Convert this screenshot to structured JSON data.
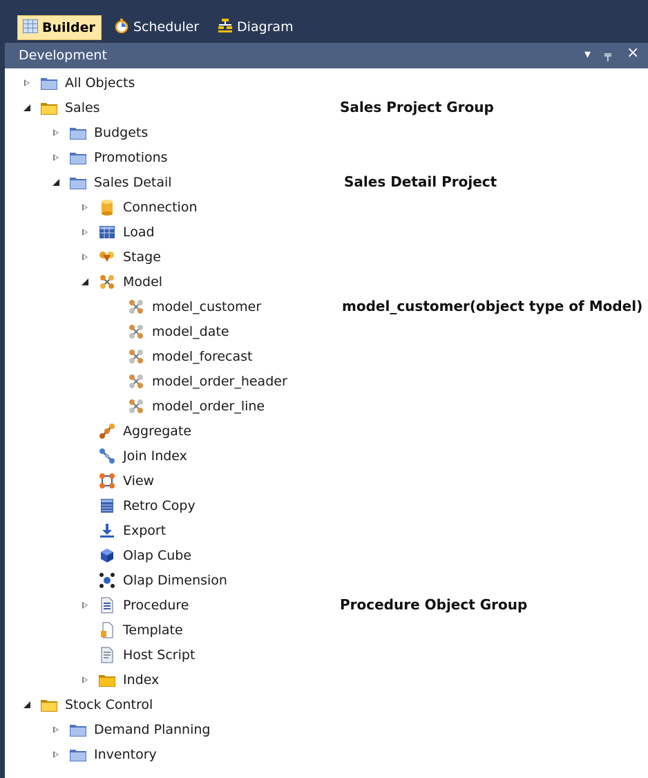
{
  "toolbar": {
    "tabs": [
      {
        "label": "Builder",
        "icon": "builder-grid-icon",
        "active": true
      },
      {
        "label": "Scheduler",
        "icon": "stopwatch-icon",
        "active": false
      },
      {
        "label": "Diagram",
        "icon": "diagram-icon",
        "active": false
      }
    ]
  },
  "panel": {
    "title": "Development",
    "buttons": [
      {
        "name": "dropdown-icon",
        "glyph": "▾"
      },
      {
        "name": "pin-icon",
        "glyph": "╤"
      },
      {
        "name": "close-icon",
        "glyph": "×"
      }
    ]
  },
  "tree": {
    "items": [
      {
        "label": "All Objects",
        "icon": "folder-blue-icon",
        "expander": "collapsed"
      },
      {
        "label": "Sales",
        "icon": "folder-yellow-icon",
        "expander": "expanded"
      },
      {
        "label": "Budgets",
        "icon": "folder-blue-icon",
        "expander": "collapsed"
      },
      {
        "label": "Promotions",
        "icon": "folder-blue-icon",
        "expander": "collapsed"
      },
      {
        "label": "Sales Detail",
        "icon": "folder-blue-icon",
        "expander": "expanded"
      },
      {
        "label": "Connection",
        "icon": "connection-cylinder-icon",
        "expander": "collapsed"
      },
      {
        "label": "Load",
        "icon": "load-table-icon",
        "expander": "collapsed"
      },
      {
        "label": "Stage",
        "icon": "stage-icon",
        "expander": "collapsed"
      },
      {
        "label": "Model",
        "icon": "model-icon",
        "expander": "expanded"
      },
      {
        "label": "model_customer",
        "icon": "model-object-icon",
        "expander": "none"
      },
      {
        "label": "model_date",
        "icon": "model-object-icon",
        "expander": "none"
      },
      {
        "label": "model_forecast",
        "icon": "model-object-icon",
        "expander": "none"
      },
      {
        "label": "model_order_header",
        "icon": "model-object-icon",
        "expander": "none"
      },
      {
        "label": "model_order_line",
        "icon": "model-object-icon",
        "expander": "none"
      },
      {
        "label": "Aggregate",
        "icon": "aggregate-icon",
        "expander": "none"
      },
      {
        "label": "Join Index",
        "icon": "join-index-icon",
        "expander": "none"
      },
      {
        "label": "View",
        "icon": "view-icon",
        "expander": "none"
      },
      {
        "label": "Retro Copy",
        "icon": "retro-copy-icon",
        "expander": "none"
      },
      {
        "label": "Export",
        "icon": "export-icon",
        "expander": "none"
      },
      {
        "label": "Olap Cube",
        "icon": "olap-cube-icon",
        "expander": "none"
      },
      {
        "label": "Olap Dimension",
        "icon": "olap-dimension-icon",
        "expander": "none"
      },
      {
        "label": "Procedure",
        "icon": "procedure-icon",
        "expander": "collapsed"
      },
      {
        "label": "Template",
        "icon": "template-icon",
        "expander": "none"
      },
      {
        "label": "Host Script",
        "icon": "host-script-icon",
        "expander": "none"
      },
      {
        "label": "Index",
        "icon": "index-icon",
        "expander": "collapsed"
      },
      {
        "label": "Stock Control",
        "icon": "folder-yellow-icon",
        "expander": "expanded"
      },
      {
        "label": "Demand Planning",
        "icon": "folder-blue-icon",
        "expander": "collapsed"
      },
      {
        "label": "Inventory",
        "icon": "folder-blue-icon",
        "expander": "collapsed"
      }
    ]
  },
  "annotations": [
    {
      "text": "Sales Project Group",
      "row": 1
    },
    {
      "text": "Sales Detail Project",
      "row": 4
    },
    {
      "text": "model_customer(object type of Model)",
      "row": 9
    },
    {
      "text": "Procedure Object Group",
      "row": 21
    }
  ],
  "colors": {
    "toolbar_bg": "#293955",
    "panel_header_bg": "#4d6082",
    "active_tab_bg": "#ffe8a6",
    "tree_bg": "#ffffff"
  }
}
